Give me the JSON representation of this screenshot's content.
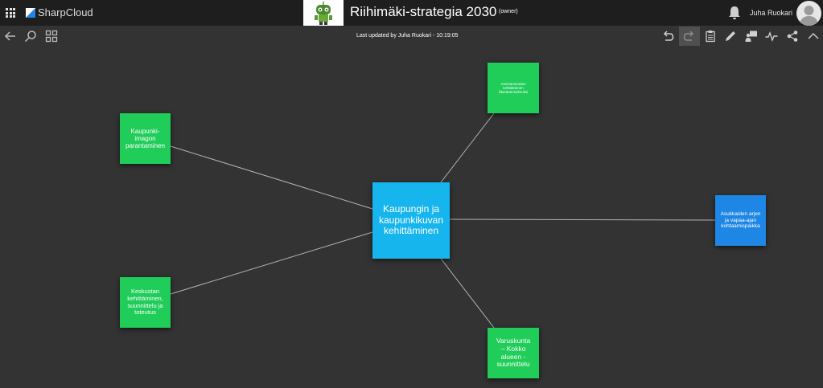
{
  "header": {
    "brand": "SharpCloud",
    "story_title": "Riihimäki-strategia 2030",
    "role": "(owner)",
    "user_name": "Juha Ruokari"
  },
  "toolbar": {
    "last_updated": "Last updated by Juha Ruokari - 10:19:05"
  },
  "colors": {
    "canvas": "#333333",
    "topbar": "#1e1e1e",
    "green_node": "#1fcd58",
    "blue_node": "#1e86e4",
    "center_node": "#16b5ee",
    "connector": "#b4b4b4"
  },
  "nodes": {
    "center": "Kaupungin ja\nkaupunkikuvan\nkehittäminen",
    "top": "Asemanseudun\nkehittäminen\nliikenteensolmuksi",
    "left_top": "Kaupunki-\nimagon\nparantaminen",
    "right": "Asukkaiden arjen\nja vapaa-ajan\nkohtaamispaikka",
    "left_bottom": "Keskustan\nkehittäminen,\nsuunnittelu ja\ntoteutus",
    "bottom": "Varuskunta\n– Kokko\nalueen -\nsuunnittelu"
  }
}
